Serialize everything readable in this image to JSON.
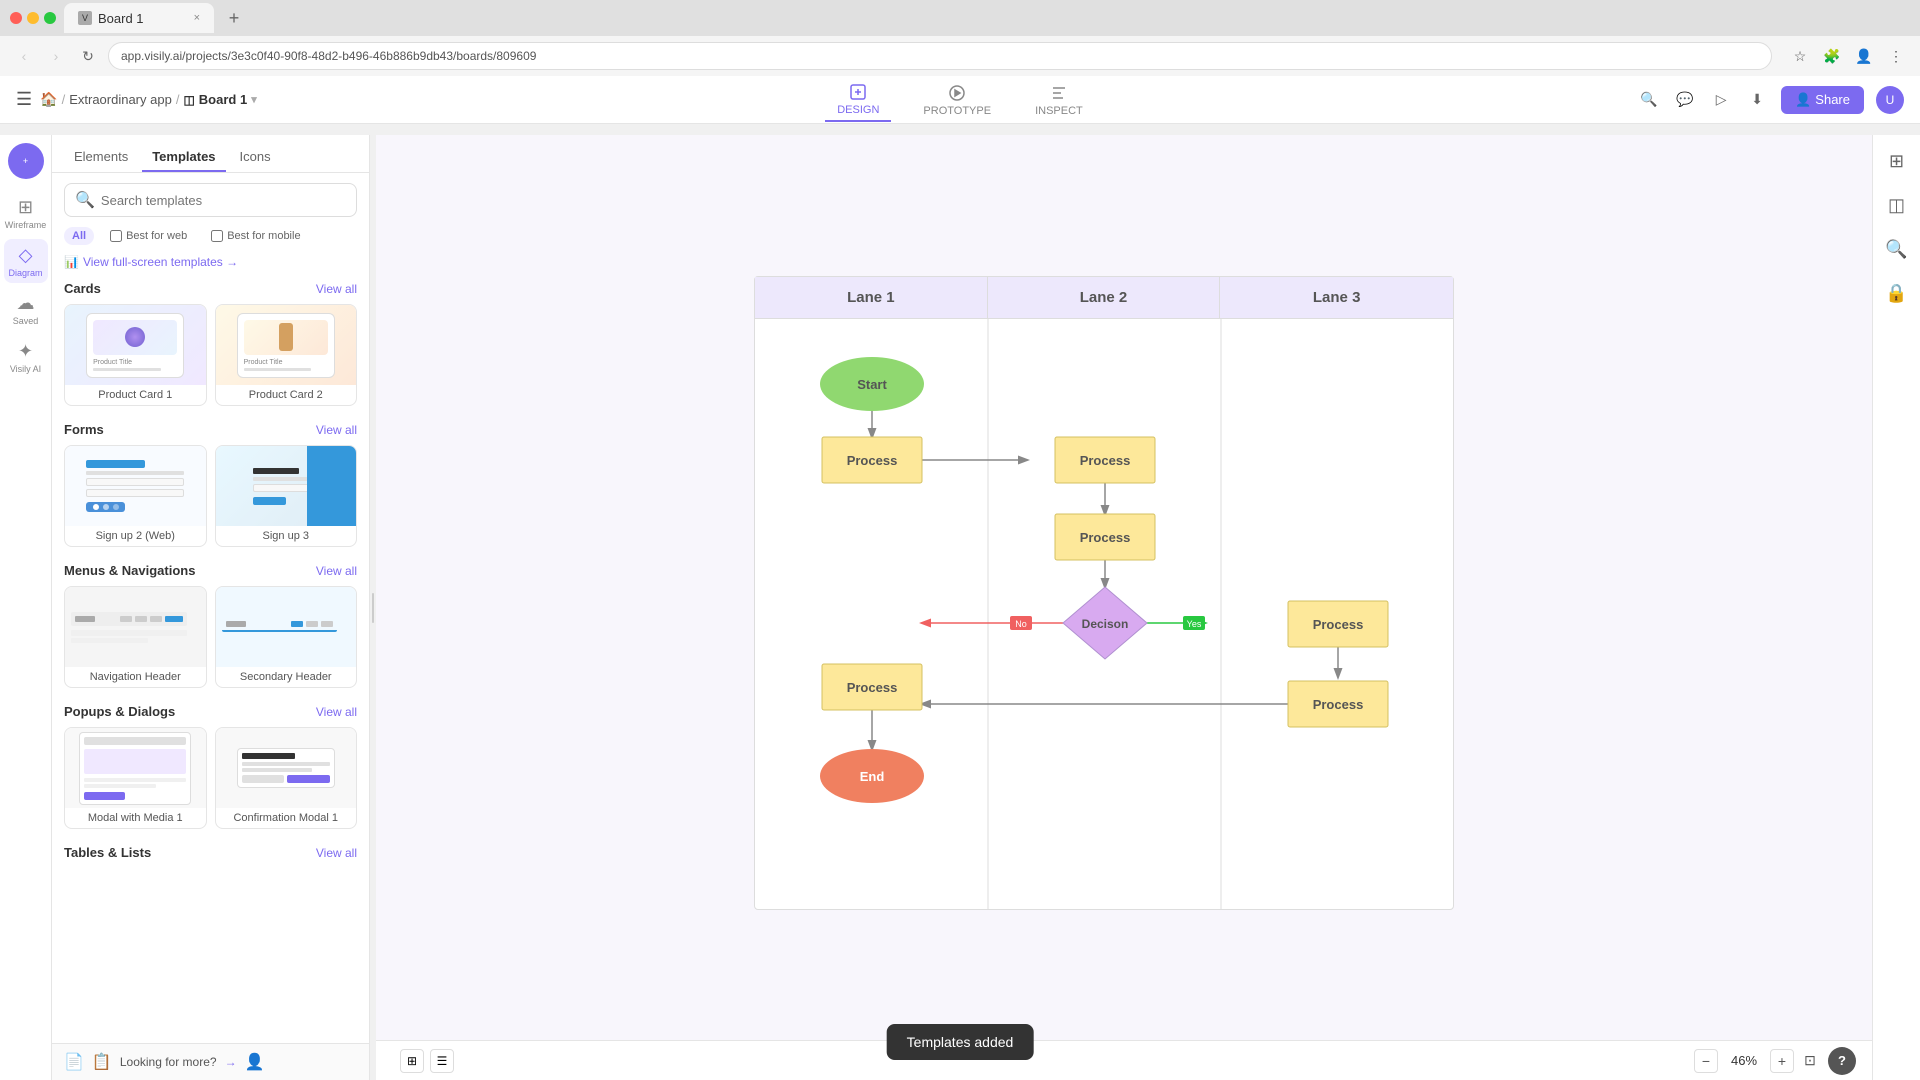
{
  "browser": {
    "tab_title": "Board 1",
    "url": "app.visily.ai/projects/3e3c0f40-90f8-48d2-b496-46b886b9db43/boards/809609",
    "new_tab_label": "+",
    "close_tab_label": "×"
  },
  "toolbar": {
    "hamburger_label": "☰",
    "home_label": "🏠",
    "breadcrumb_app": "Extraordinary app",
    "breadcrumb_sep": "/",
    "breadcrumb_board": "Board 1",
    "tabs": [
      {
        "id": "design",
        "label": "DESIGN",
        "active": true
      },
      {
        "id": "prototype",
        "label": "PROTOTYPE",
        "active": false
      },
      {
        "id": "inspect",
        "label": "INSPECT",
        "active": false
      }
    ],
    "search_label": "🔍",
    "share_label": "Share"
  },
  "left_sidebar": {
    "items": [
      {
        "id": "add",
        "icon": "+",
        "label": "Add",
        "active": false,
        "is_add": true
      },
      {
        "id": "wireframe",
        "icon": "⊞",
        "label": "Wireframe",
        "active": false
      },
      {
        "id": "diagram",
        "icon": "◇",
        "label": "Diagram",
        "active": false
      },
      {
        "id": "saved",
        "icon": "☁",
        "label": "Saved",
        "active": false
      },
      {
        "id": "visily-ai",
        "icon": "✦",
        "label": "Visily AI",
        "active": false
      }
    ]
  },
  "templates_panel": {
    "tabs": [
      {
        "id": "elements",
        "label": "Elements",
        "active": false
      },
      {
        "id": "templates",
        "label": "Templates",
        "active": true
      },
      {
        "id": "icons",
        "label": "Icons",
        "active": false
      }
    ],
    "search_placeholder": "Search templates",
    "filters": [
      {
        "id": "all",
        "label": "All",
        "active": true
      },
      {
        "id": "best-web",
        "label": "Best for web",
        "active": false,
        "has_checkbox": true
      },
      {
        "id": "best-mobile",
        "label": "Best for mobile",
        "active": false,
        "has_checkbox": true
      }
    ],
    "view_full_screen": "View full-screen templates →",
    "sections": [
      {
        "id": "cards",
        "title": "Cards",
        "view_all": "View all",
        "items": [
          {
            "id": "product-card-1",
            "label": "Product Card 1"
          },
          {
            "id": "product-card-2",
            "label": "Product Card 2"
          }
        ]
      },
      {
        "id": "forms",
        "title": "Forms",
        "view_all": "View all",
        "items": [
          {
            "id": "sign-up-web",
            "label": "Sign up 2 (Web)"
          },
          {
            "id": "sign-up-3",
            "label": "Sign up 3"
          }
        ]
      },
      {
        "id": "menus-navigations",
        "title": "Menus & Navigations",
        "view_all": "View all",
        "items": [
          {
            "id": "nav-header",
            "label": "Navigation Header"
          },
          {
            "id": "secondary-header",
            "label": "Secondary Header"
          }
        ]
      },
      {
        "id": "popups-dialogs",
        "title": "Popups & Dialogs",
        "view_all": "View all",
        "items": [
          {
            "id": "modal-media-1",
            "label": "Modal with Media 1"
          },
          {
            "id": "confirm-modal-1",
            "label": "Confirmation Modal 1"
          }
        ]
      },
      {
        "id": "tables-lists",
        "title": "Tables & Lists",
        "view_all": "View all",
        "items": []
      }
    ],
    "bottom_bar": "Looking for more?",
    "bottom_bar_icon": "🔍"
  },
  "canvas": {
    "lanes": [
      {
        "id": "lane1",
        "label": "Lane 1"
      },
      {
        "id": "lane2",
        "label": "Lane 2"
      },
      {
        "id": "lane3",
        "label": "Lane 3"
      }
    ],
    "shapes": [
      {
        "id": "start",
        "type": "start",
        "label": "Start"
      },
      {
        "id": "process1",
        "type": "process",
        "label": "Process"
      },
      {
        "id": "process2",
        "type": "process",
        "label": "Process"
      },
      {
        "id": "process3",
        "type": "process",
        "label": "Process"
      },
      {
        "id": "decision",
        "type": "decision",
        "label": "Decison"
      },
      {
        "id": "process4",
        "type": "process",
        "label": "Process"
      },
      {
        "id": "process5",
        "type": "process",
        "label": "Process"
      },
      {
        "id": "process6",
        "type": "process",
        "label": "Process"
      },
      {
        "id": "end",
        "type": "end",
        "label": "End"
      }
    ]
  },
  "status_toast": {
    "label": "Templates added"
  },
  "bottom_toolbar": {
    "zoom_level": "46%",
    "zoom_in": "+",
    "zoom_out": "−",
    "help": "?"
  },
  "right_sidebar": {
    "buttons": [
      {
        "id": "settings",
        "icon": "⊞"
      },
      {
        "id": "layers",
        "icon": "◫"
      },
      {
        "id": "search",
        "icon": "🔍"
      },
      {
        "id": "lock",
        "icon": "🔒"
      }
    ]
  },
  "colors": {
    "accent": "#7c6af0",
    "lane_header_bg": "#e8e0f8",
    "start_shape": "#90d870",
    "process_shape": "#fde89a",
    "decision_shape": "#d8aaf0",
    "end_shape": "#f08060",
    "no_label_bg": "#febc2e",
    "yes_label_bg": "#28c840"
  }
}
